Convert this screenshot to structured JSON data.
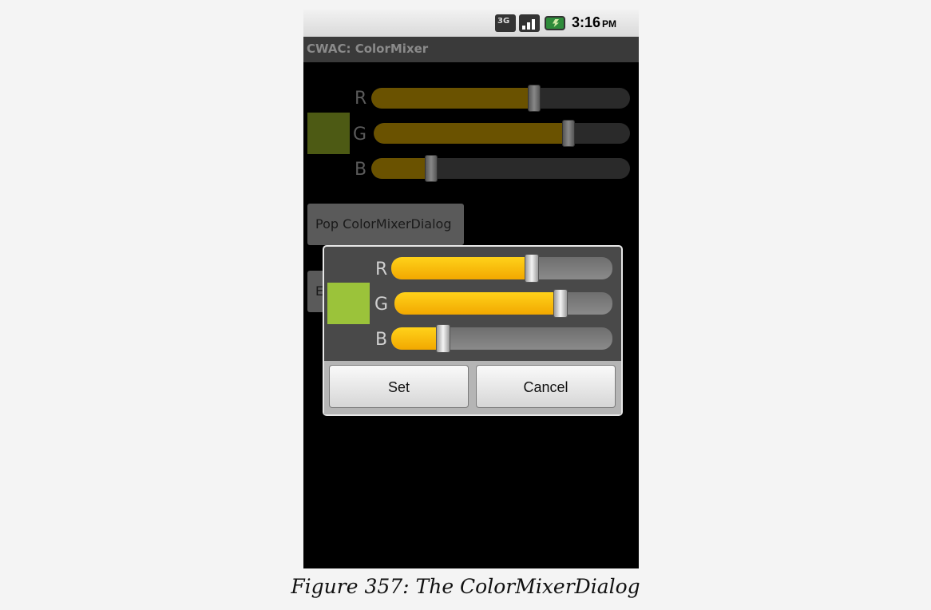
{
  "status_bar": {
    "network_label": "3G",
    "time": "3:16",
    "ampm": "PM",
    "icons": [
      "network-3g-icon",
      "signal-strength-icon",
      "battery-charging-icon"
    ]
  },
  "app": {
    "title": "CWAC: ColorMixer"
  },
  "background_mixer": {
    "swatch_color": "#4d5a14",
    "sliders": [
      {
        "label": "R",
        "value": 0.63
      },
      {
        "label": "G",
        "value": 0.76
      },
      {
        "label": "B",
        "value": 0.23
      }
    ]
  },
  "background_buttons": {
    "pop_dialog_label": "Pop ColorMixerDialog",
    "partial_button_label": "E"
  },
  "dialog": {
    "swatch_color": "#9bc33a",
    "sliders": [
      {
        "label": "R",
        "value": 0.63
      },
      {
        "label": "G",
        "value": 0.76
      },
      {
        "label": "B",
        "value": 0.23
      }
    ],
    "set_label": "Set",
    "cancel_label": "Cancel"
  },
  "caption": "Figure 357: The ColorMixerDialog"
}
